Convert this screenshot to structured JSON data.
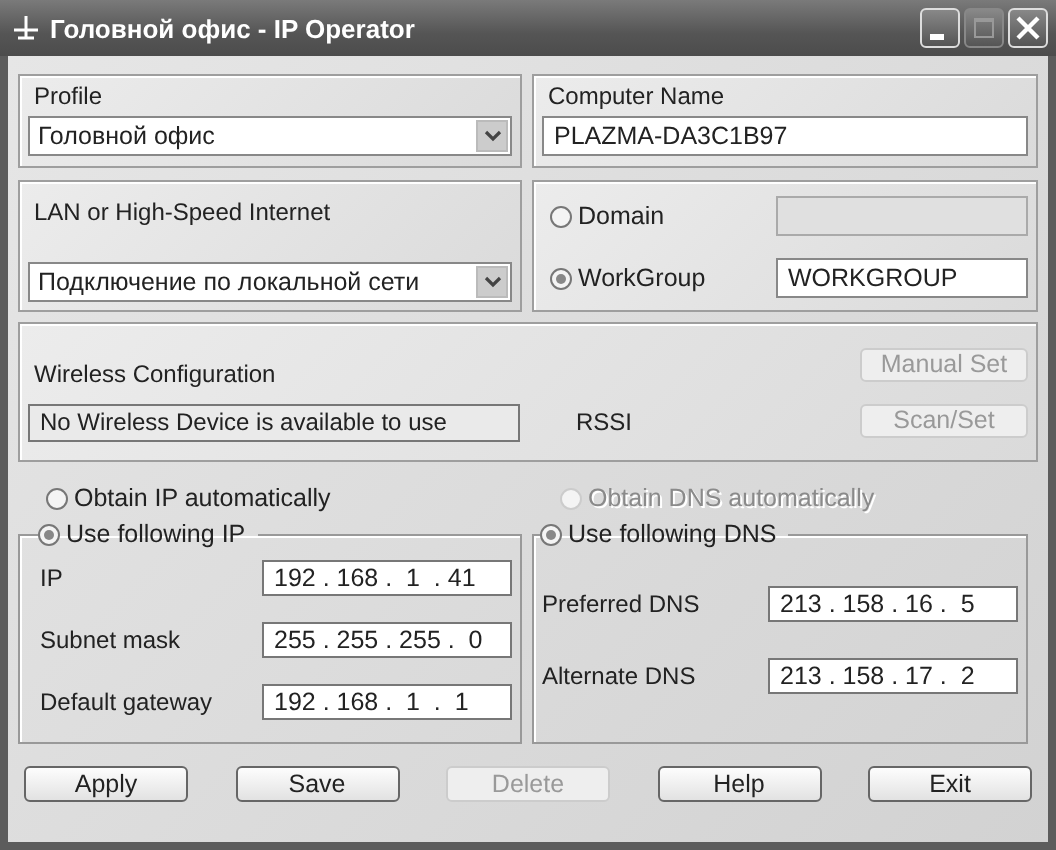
{
  "window": {
    "title": "Головной офис - IP Operator"
  },
  "profile": {
    "label": "Profile",
    "value": "Головной офис"
  },
  "computer_name": {
    "label": "Computer Name",
    "value": "PLAZMA-DA3C1B97"
  },
  "connection": {
    "label": "LAN or High-Speed Internet",
    "value": "Подключение по локальной сети"
  },
  "membership": [
    {
      "label": "Domain",
      "selected": false
    },
    {
      "label": "WorkGroup",
      "selected": true,
      "value": "WORKGROUP"
    }
  ],
  "wireless": {
    "label": "Wireless Configuration",
    "status": "No Wireless Device is available to use",
    "rssi_label": "RSSI",
    "buttons": [
      {
        "label": "Manual Set",
        "disabled": true
      },
      {
        "label": "Scan/Set",
        "disabled": true
      }
    ]
  },
  "ip": {
    "modes": [
      {
        "label": "Obtain IP automatically",
        "selected": false,
        "disabled": false
      },
      {
        "label": "Use following IP",
        "selected": true,
        "disabled": false
      }
    ],
    "fields": [
      {
        "label": "IP",
        "value": "192 . 168 .  1  . 41"
      },
      {
        "label": "Subnet mask",
        "value": "255 . 255 . 255 .  0"
      },
      {
        "label": "Default gateway",
        "value": "192 . 168 .  1  .  1"
      }
    ]
  },
  "dns": {
    "modes": [
      {
        "label": "Obtain DNS automatically",
        "selected": false,
        "disabled": true
      },
      {
        "label": "Use following DNS",
        "selected": true,
        "disabled": false
      }
    ],
    "fields": [
      {
        "label": "Preferred DNS",
        "value": "213 . 158 . 16 .  5"
      },
      {
        "label": "Alternate DNS",
        "value": "213 . 158 . 17 .  2"
      }
    ]
  },
  "buttons": [
    {
      "label": "Apply",
      "disabled": false
    },
    {
      "label": "Save",
      "disabled": false
    },
    {
      "label": "Delete",
      "disabled": true
    },
    {
      "label": "Help",
      "disabled": false
    },
    {
      "label": "Exit",
      "disabled": false
    }
  ]
}
